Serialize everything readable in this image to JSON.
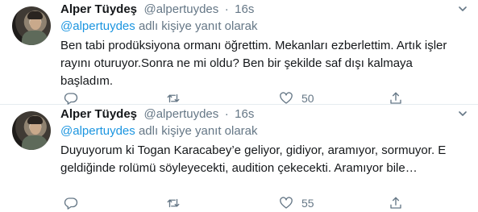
{
  "tweets": [
    {
      "display_name": "Alper Tüydeş",
      "handle": "@alpertuydes",
      "separator": "·",
      "time": "16s",
      "reply_to_handle": "@alpertuydes",
      "reply_suffix": "adlı kişiye yanıt olarak",
      "text": "Ben tabi prodüksiyona ormanı öğrettim. Mekanları ezberlettim. Artık işler rayını oturuyor.Sonra ne mi oldu? Ben bir şekilde saf dışı kalmaya başladım.",
      "like_count": "50"
    },
    {
      "display_name": "Alper Tüydeş",
      "handle": "@alpertuydes",
      "separator": "·",
      "time": "16s",
      "reply_to_handle": "@alpertuydes",
      "reply_suffix": "adlı kişiye yanıt olarak",
      "text": "Duyuyorum ki Togan Karacabey’e geliyor, gidiyor, aramıyor, sormuyor. E geldiğinde rolümü söyleyecekti, audition çekecekti. Aramıyor bile…",
      "like_count": "55"
    }
  ],
  "icons": {
    "reply": "reply-icon",
    "retweet": "retweet-icon",
    "like": "heart-icon",
    "share": "share-icon",
    "menu": "chevron-down-icon"
  },
  "colors": {
    "text": "#14171a",
    "secondary": "#657786",
    "mention": "#1b95e0",
    "divider": "#e6ecf0"
  }
}
